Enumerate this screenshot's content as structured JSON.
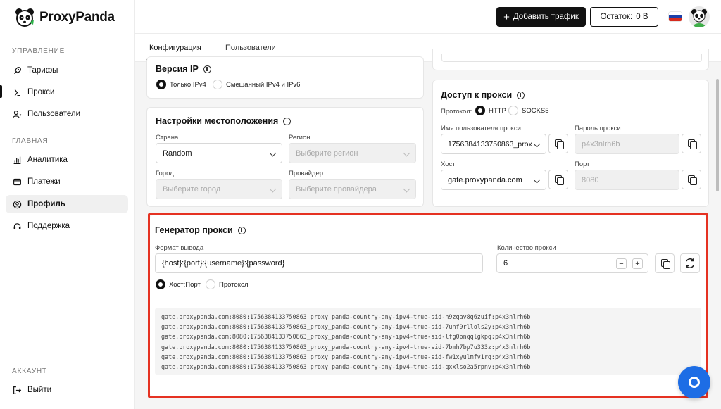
{
  "brand": {
    "name": "ProxyPanda"
  },
  "sidebar": {
    "section_manage": "УПРАВЛЕНИЕ",
    "section_main": "ГЛАВНАЯ",
    "section_account": "АККАУНТ",
    "items": [
      {
        "label": "Тарифы",
        "icon": "rocket-icon"
      },
      {
        "label": "Прокси",
        "icon": "proxy-icon"
      },
      {
        "label": "Пользователи",
        "icon": "users-icon"
      },
      {
        "label": "Аналитика",
        "icon": "bar-chart-icon"
      },
      {
        "label": "Платежи",
        "icon": "wallet-icon"
      },
      {
        "label": "Профиль",
        "icon": "profile-icon"
      },
      {
        "label": "Поддержка",
        "icon": "headset-icon"
      }
    ],
    "logout": "Выйти"
  },
  "header": {
    "add_traffic": "Добавить трафик",
    "balance_label": "Остаток:",
    "balance_value": "0 B",
    "language_flag": "russia-flag-icon"
  },
  "tabs": [
    {
      "label": "Конфигурация"
    },
    {
      "label": "Пользователи"
    }
  ],
  "ip_version": {
    "title": "Версия IP",
    "option_ipv4": "Только IPv4",
    "option_mixed": "Смешанный IPv4 и IPv6",
    "selected": "ipv4"
  },
  "location": {
    "title": "Настройки местоположения",
    "country_label": "Страна",
    "country_value": "Random",
    "region_label": "Регион",
    "region_placeholder": "Выберите регион",
    "city_label": "Город",
    "city_placeholder": "Выберите город",
    "provider_label": "Провайдер",
    "provider_placeholder": "Выберите провайдера"
  },
  "access": {
    "title": "Доступ к прокси",
    "protocol_label": "Протокол:",
    "protocol_http": "HTTP",
    "protocol_socks": "SOCKS5",
    "selected_protocol": "HTTP",
    "username_label": "Имя пользователя прокси",
    "username_value": "1756384133750863_prox",
    "password_label": "Пароль прокси",
    "password_value": "p4x3nlrh6b",
    "host_label": "Хост",
    "host_value": "gate.proxypanda.com",
    "port_label": "Порт",
    "port_value": "8080"
  },
  "generator": {
    "title": "Генератор прокси",
    "format_label": "Формат вывода",
    "format_value": "{host}:{port}:{username}:{password}",
    "count_label": "Количество прокси",
    "count_value": "6",
    "minus": "−",
    "plus": "+",
    "mode_hostport": "Хост:Порт",
    "mode_protocol": "Протокол",
    "selected_mode": "hostport",
    "lines": [
      "gate.proxypanda.com:8080:1756384133750863_proxy_panda-country-any-ipv4-true-sid-n9zqav8g6zuif:p4x3nlrh6b",
      "gate.proxypanda.com:8080:1756384133750863_proxy_panda-country-any-ipv4-true-sid-7unf9rllols2y:p4x3nlrh6b",
      "gate.proxypanda.com:8080:1756384133750863_proxy_panda-country-any-ipv4-true-sid-lfg0pnqqlgkpq:p4x3nlrh6b",
      "gate.proxypanda.com:8080:1756384133750863_proxy_panda-country-any-ipv4-true-sid-7bmh7bp7u333z:p4x3nlrh6b",
      "gate.proxypanda.com:8080:1756384133750863_proxy_panda-country-any-ipv4-true-sid-fw1xyulmfv1rq:p4x3nlrh6b",
      "gate.proxypanda.com:8080:1756384133750863_proxy_panda-country-any-ipv4-true-sid-qxxlso2a5rpnv:p4x3nlrh6b"
    ]
  },
  "colors": {
    "accent": "#111111",
    "highlight": "#e53222",
    "chat": "#1d6de5"
  }
}
